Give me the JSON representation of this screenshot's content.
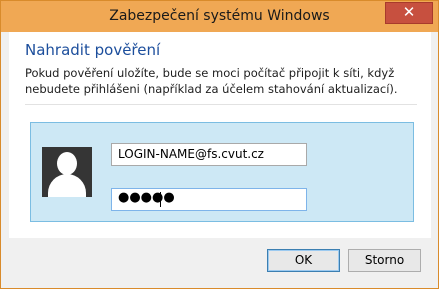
{
  "window": {
    "title": "Zabezpečení systému Windows",
    "close_icon": "close-icon"
  },
  "content": {
    "heading": "Nahradit pověření",
    "description": "Pokud pověření uložíte, bude se moci počítač připojit k síti, když nebudete přihlášeni (například za účelem stahování aktualizací)."
  },
  "credential": {
    "avatar_icon": "user-avatar-icon",
    "username_value": "LOGIN-NAME@fs.cvut.cz",
    "password_mask": "●●●●●"
  },
  "buttons": {
    "ok_label": "OK",
    "cancel_label": "Storno"
  },
  "colors": {
    "titlebar": "#f0a854",
    "heading": "#1c4e9c",
    "tile_background": "#cde8f5",
    "tile_border": "#7bbde2",
    "close_button": "#c7503f"
  }
}
